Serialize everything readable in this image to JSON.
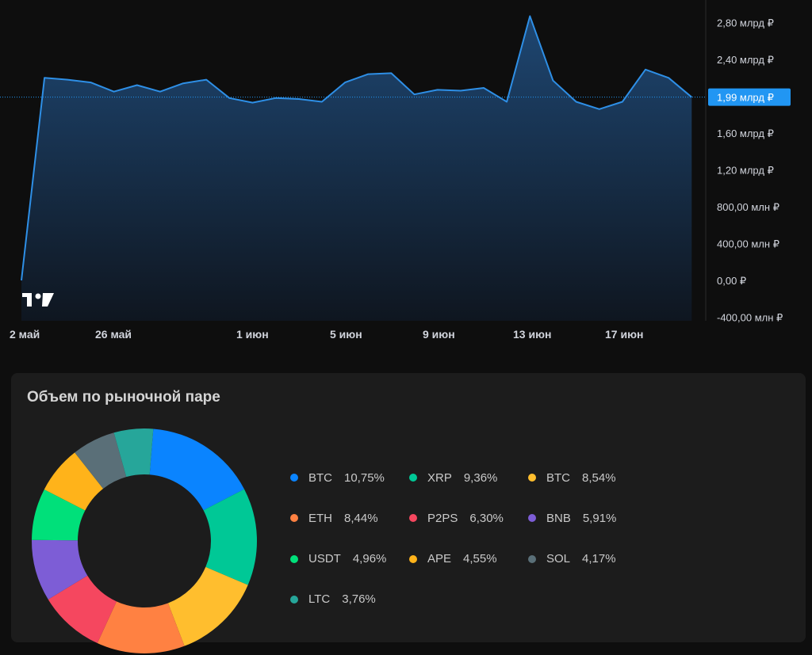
{
  "chart_data": [
    {
      "type": "area",
      "x_tick_labels": [
        "2 май",
        "26 май",
        "1 июн",
        "5 июн",
        "9 июн",
        "13 июн",
        "17 июн"
      ],
      "y_tick_labels": [
        "2,80 млрд ₽",
        "2,40 млрд ₽",
        "1,99 млрд ₽",
        "1,60 млрд ₽",
        "1,20 млрд ₽",
        "800,00 млн ₽",
        "400,00 млн ₽",
        "0,00 ₽",
        "-400,00 млн ₽"
      ],
      "ylim": [
        -400,
        2800
      ],
      "unit": "млн ₽",
      "current_value": 1990,
      "current_value_label": "1,99 млрд ₽",
      "line_color": "#2e8fe6",
      "tag_color": "#2196f3",
      "values": [
        0,
        2200,
        2180,
        2150,
        2050,
        2120,
        2050,
        2140,
        2180,
        1980,
        1930,
        1980,
        1970,
        1940,
        2150,
        2240,
        2250,
        2020,
        2070,
        2060,
        2090,
        1940,
        2870,
        2170,
        1940,
        1860,
        1940,
        2290,
        2200,
        1990
      ]
    },
    {
      "type": "pie",
      "title": "Объем по рыночной паре",
      "slices": [
        {
          "label": "BTC",
          "percent_label": "10,75%",
          "value": 10.75,
          "color": "#0a84ff"
        },
        {
          "label": "XRP",
          "percent_label": "9,36%",
          "value": 9.36,
          "color": "#00c896"
        },
        {
          "label": "BTC",
          "percent_label": "8,54%",
          "value": 8.54,
          "color": "#ffbe2e"
        },
        {
          "label": "ETH",
          "percent_label": "8,44%",
          "value": 8.44,
          "color": "#ff8142"
        },
        {
          "label": "P2PS",
          "percent_label": "6,30%",
          "value": 6.3,
          "color": "#f5475f"
        },
        {
          "label": "BNB",
          "percent_label": "5,91%",
          "value": 5.91,
          "color": "#7d5dd6"
        },
        {
          "label": "USDT",
          "percent_label": "4,96%",
          "value": 4.96,
          "color": "#00e07a"
        },
        {
          "label": "APE",
          "percent_label": "4,55%",
          "value": 4.55,
          "color": "#ffb31a"
        },
        {
          "label": "SOL",
          "percent_label": "4,17%",
          "value": 4.17,
          "color": "#5a6f78"
        },
        {
          "label": "LTC",
          "percent_label": "3,76%",
          "value": 3.76,
          "color": "#26a69a"
        }
      ]
    }
  ],
  "watermark_logo": "tradingview-logo-icon"
}
